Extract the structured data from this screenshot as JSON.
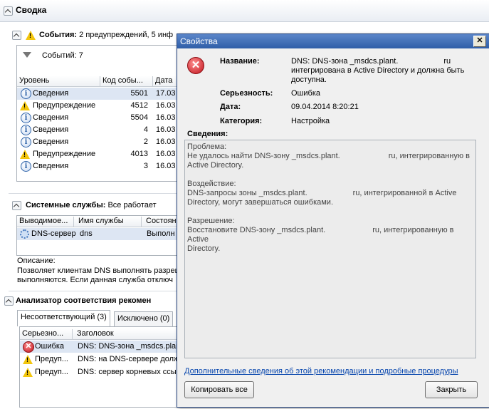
{
  "window": {
    "title": "Сводка"
  },
  "events": {
    "header_title": "События:",
    "header_rest": "2 предупреждений, 5 инф",
    "count_label": "Событий: 7",
    "columns": [
      "Уровень",
      "Код собы...",
      "Дата"
    ],
    "rows": [
      {
        "level": "Сведения",
        "type": "info",
        "code": "5501",
        "date": "17.03"
      },
      {
        "level": "Предупреждение",
        "type": "warn",
        "code": "4512",
        "date": "16.03"
      },
      {
        "level": "Сведения",
        "type": "info",
        "code": "5504",
        "date": "16.03"
      },
      {
        "level": "Сведения",
        "type": "info",
        "code": "4",
        "date": "16.03"
      },
      {
        "level": "Сведения",
        "type": "info",
        "code": "2",
        "date": "16.03"
      },
      {
        "level": "Предупреждение",
        "type": "warn",
        "code": "4013",
        "date": "16.03"
      },
      {
        "level": "Сведения",
        "type": "info",
        "code": "3",
        "date": "16.03"
      }
    ]
  },
  "services": {
    "header_title": "Системные службы:",
    "header_rest": "Все работает",
    "columns": [
      "Выводимое...",
      "Имя службы",
      "Состоян"
    ],
    "row": {
      "display": "DNS-сервер",
      "name": "dns",
      "state": "Выполн"
    },
    "desc_label": "Описание:",
    "desc_line1": "Позволяет клиентам DNS выполнять разреш",
    "desc_line2": "выполняются. Если данная служба отключ"
  },
  "bpa": {
    "header_title": "Анализатор соответствия рекомен",
    "tabs": [
      "Несоответствующий (3)",
      "Исключено (0)"
    ],
    "columns": [
      "Серьезно...",
      "Заголовок"
    ],
    "rows": [
      {
        "severity": "Ошибка",
        "type": "error",
        "title": "DNS: DNS-зона _msdcs.plant"
      },
      {
        "severity": "Предуп...",
        "type": "warn",
        "title": "DNS: на DNS-сервере долж"
      },
      {
        "severity": "Предуп...",
        "type": "warn",
        "title": "DNS: сервер корневых ссы"
      }
    ]
  },
  "dialog": {
    "title": "Свойства",
    "close_glyph": "✕",
    "name_label": "Название:",
    "name_line1a": "DNS: DNS-зона _msdcs.plant.",
    "name_line1b": "ru",
    "name_line2": "интегрирована в Active Directory и должна быть",
    "name_line3": "доступна.",
    "severity_label": "Серьезность:",
    "severity_value": "Ошибка",
    "date_label": "Дата:",
    "date_value": "09.04.2014 8:20:21",
    "category_label": "Категория:",
    "category_value": "Настройка",
    "details_label": "Сведения:",
    "problem_h": "Проблема:",
    "problem_a": "Не удалось найти DNS-зону _msdcs.plant.",
    "problem_b": "ru, интегрированную в",
    "problem_c": "Active Directory.",
    "impact_h": "Воздействие:",
    "impact_a": "DNS-запросы зоны _msdcs.plant.",
    "impact_b": "ru, интегрированной в Active",
    "impact_c": "Directory, могут завершаться ошибками.",
    "resolution_h": "Разрешение:",
    "resolution_a": "Восстановите DNS-зону _msdcs.plant.",
    "resolution_b": "ru, интегрированную в Active",
    "resolution_c": "Directory.",
    "more_link": "Дополнительные сведения об этой рекомендации и подробные процедуры",
    "copy_button": "Копировать все",
    "close_button": "Закрыть"
  }
}
